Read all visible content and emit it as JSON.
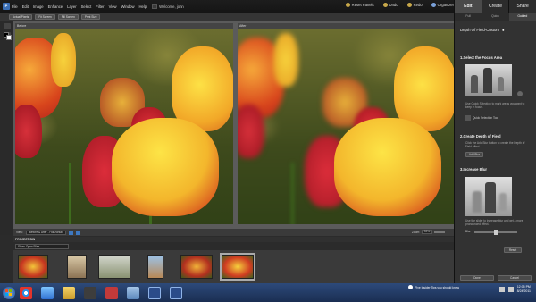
{
  "app": {
    "icon_letter": "P"
  },
  "menu": [
    "File",
    "Edit",
    "Image",
    "Enhance",
    "Layer",
    "Select",
    "Filter",
    "View",
    "Window",
    "Help"
  ],
  "workspace": {
    "label": "Welcome, john"
  },
  "top_actions": [
    "Reset Panels",
    "Undo",
    "Redo",
    "Organizer"
  ],
  "top_tabs": [
    "Edit",
    "Create",
    "Share"
  ],
  "view_buttons": [
    "Actual Pixels",
    "Fit Screen",
    "Fill Screen",
    "Print Size"
  ],
  "panes": {
    "before": "Before",
    "after": "After"
  },
  "status": {
    "view_label": "View:",
    "view_value": "Before & After - Horizontal",
    "zoom_label": "Zoom:",
    "zoom_value": "39%"
  },
  "bin": {
    "title": "PROJECT BIN",
    "filter": "Show Open Files"
  },
  "subtabs": [
    "Full",
    "Quick",
    "Guided"
  ],
  "panel": {
    "title": "Depth Of Field-Custom",
    "s1_title": "1.Select the Focus Area",
    "s1_desc": "Use Quick Selection to mark areas you want to keep in focus.",
    "s1_tool": "Quick Selection Tool",
    "s2_title": "2.Create Depth of Field",
    "s2_desc": "Click the Add Blur button to create the Depth of Field effect.",
    "s2_button": "Add Blur",
    "s3_title": "3.Increase Blur",
    "s3_desc": "Use the slider to increase blur and get a more pronounced effect.",
    "blur_label": "Blur",
    "blur_level": 0.5,
    "reset": "Reset",
    "done": "Done",
    "cancel": "Cancel"
  },
  "taskbar": {
    "tip": "Five Insider Tips you should know",
    "time": "12:05 PM",
    "date": "8/24/2011"
  }
}
